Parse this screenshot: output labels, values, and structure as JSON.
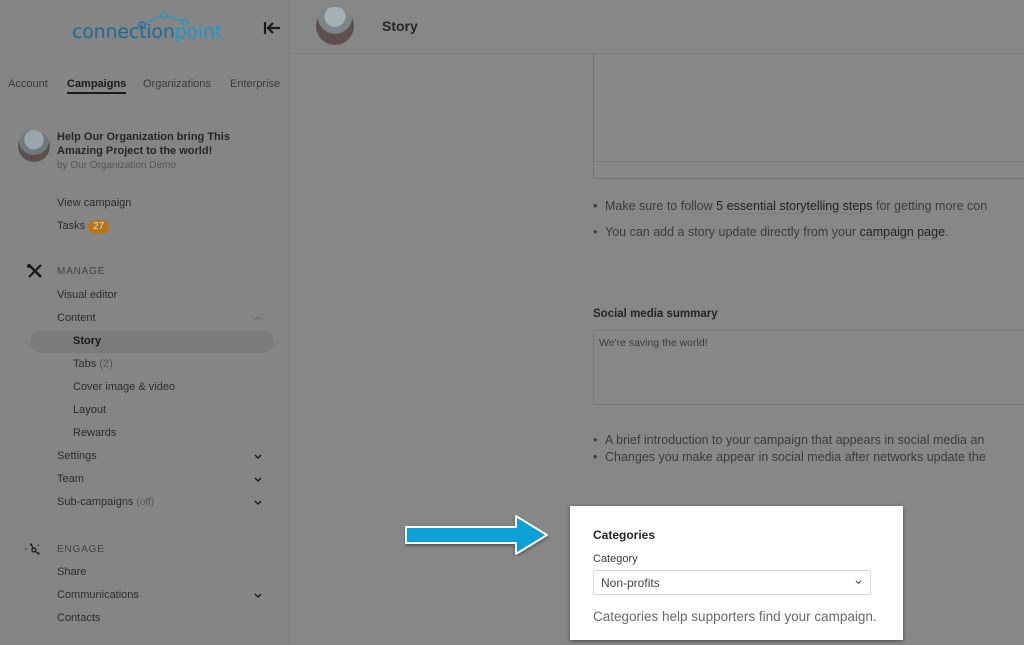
{
  "brand": {
    "name_part1": "connection",
    "name_part2": "point",
    "colors": {
      "primary": "#1d6c9a",
      "secondary": "#1f95c9"
    }
  },
  "sidebar": {
    "collapse_icon": "collapse-left-icon",
    "tabs": [
      {
        "label": "Account",
        "active": false
      },
      {
        "label": "Campaigns",
        "active": true
      },
      {
        "label": "Organizations",
        "active": false
      },
      {
        "label": "Enterprise",
        "active": false
      }
    ],
    "campaign": {
      "title": "Help Our Organization bring This Amazing Project to the world!",
      "byline": "by Our Organization Demo"
    },
    "links": {
      "view_campaign": "View campaign",
      "tasks": "Tasks",
      "tasks_count": "27"
    },
    "manage": {
      "heading": "MANAGE",
      "icon": "tools-icon",
      "items": {
        "visual_editor": "Visual editor",
        "content": "Content",
        "story": "Story",
        "tabs": "Tabs",
        "tabs_count": "(2)",
        "cover": "Cover image & video",
        "layout": "Layout",
        "rewards": "Rewards",
        "settings": "Settings",
        "team": "Team",
        "subcampaigns": "Sub-campaigns",
        "subcampaigns_state": "(off)"
      }
    },
    "engage": {
      "heading": "ENGAGE",
      "icon": "network-icon",
      "items": {
        "share": "Share",
        "communications": "Communications",
        "contacts": "Contacts"
      }
    }
  },
  "header": {
    "title": "Story"
  },
  "main": {
    "story_tips": {
      "tip1_pre": "Make sure to follow ",
      "tip1_link": "5 essential storytelling steps",
      "tip1_post": " for getting more con",
      "tip2_pre": "You can add a story update directly from your ",
      "tip2_link": "campaign page",
      "tip2_post": "."
    },
    "social_summary": {
      "label": "Social media summary",
      "value": "We're saving the world!",
      "tips": [
        "A brief introduction to your campaign that appears in social media an",
        "Changes you make appear in social media after networks update the"
      ]
    },
    "categories": {
      "title": "Categories",
      "field_label": "Category",
      "selected": "Non-profits",
      "help": "Categories help supporters find your campaign."
    },
    "callout_arrow_color": "#0aa0d8"
  }
}
